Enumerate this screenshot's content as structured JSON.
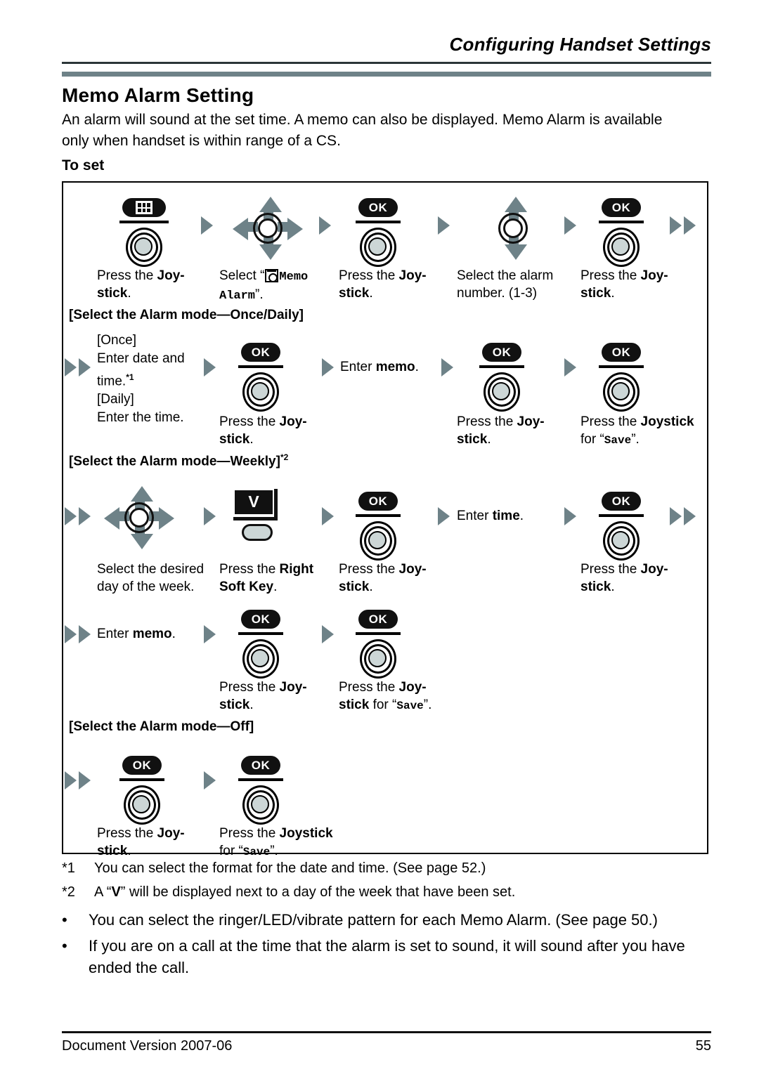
{
  "header": {
    "title": "Configuring Handset Settings"
  },
  "page_title": "Memo Alarm Setting",
  "intro": "An alarm will sound at the set time. A memo can also be displayed. Memo Alarm is available only when handset is within range of a CS.",
  "subhead": "To set",
  "flow": {
    "row1": {
      "captions": [
        "Press the Joy-stick.",
        "Select “[clock]Memo Alarm”.",
        "Press the Joy-stick.",
        "Select the alarm number. (1-3)",
        "Press the Joy-stick."
      ],
      "c1_a": "Press the ",
      "c1_b": "Joy-",
      "c1_c": "stick",
      "c1_d": ".",
      "c2_a": "Select “",
      "c2_mono1": "Memo",
      "c2_mono2": "Alarm",
      "c2_end": "”.",
      "c3_a": "Press the ",
      "c3_b": "Joy-",
      "c3_c": "stick",
      "c3_d": ".",
      "c4_l1": "Select the alarm",
      "c4_l2": "number. (1-3)",
      "c5_a": "Press the ",
      "c5_b": "Joy-",
      "c5_c": "stick",
      "c5_d": ".",
      "key1_label": "menu-grid",
      "key2_label": "OK",
      "key3_label": "OK"
    },
    "section_once": {
      "heading": "[Select the Alarm mode—Once/Daily]",
      "col1": [
        "[Once]",
        "Enter date and",
        "time.",
        "[Daily]",
        "Enter the time."
      ],
      "col1_sup": "*1",
      "ok_label": "OK",
      "cap_ok1_a": "Press the ",
      "cap_ok1_b": "Joy-",
      "cap_ok1_c": "stick",
      "cap_ok1_d": ".",
      "enter_memo_a": "Enter ",
      "enter_memo_b": "memo",
      "enter_memo_c": ".",
      "cap_ok2_a": "Press the ",
      "cap_ok2_b": "Joy-",
      "cap_ok2_c": "stick",
      "cap_ok2_d": ".",
      "cap_ok3_a": "Press the ",
      "cap_ok3_b": "Joystick",
      "cap_ok3_c": "for “",
      "cap_ok3_mono": "Save",
      "cap_ok3_d": "”."
    },
    "section_weekly": {
      "heading": "[Select the Alarm mode—Weekly]",
      "heading_sup": "*2",
      "softkey_glyph": "V",
      "ok_label": "OK",
      "cap_day_l1": "Select the desired",
      "cap_day_l2": "day of the week.",
      "cap_soft_a": "Press the ",
      "cap_soft_b": "Right",
      "cap_soft_c": "Soft Key",
      "cap_soft_d": ".",
      "cap_ok1_a": "Press the ",
      "cap_ok1_b": "Joy-",
      "cap_ok1_c": "stick",
      "cap_ok1_d": ".",
      "enter_time_a": "Enter ",
      "enter_time_b": "time",
      "enter_time_c": ".",
      "cap_ok2_a": "Press the ",
      "cap_ok2_b": "Joy-",
      "cap_ok2_c": "stick",
      "cap_ok2_d": ".",
      "enter_memo_a": "Enter ",
      "enter_memo_b": "memo",
      "enter_memo_c": ".",
      "cap_ok3_a": "Press the ",
      "cap_ok3_b": "Joy-",
      "cap_ok3_c": "stick",
      "cap_ok3_d": ".",
      "cap_ok4_a": "Press the ",
      "cap_ok4_b": "Joy-",
      "cap_ok4_c": "stick",
      "cap_ok4_d": " for “",
      "cap_ok4_mono": "Save",
      "cap_ok4_e": "”."
    },
    "section_off": {
      "heading": "[Select the Alarm mode—Off]",
      "ok_label": "OK",
      "cap_ok1_a": "Press the ",
      "cap_ok1_b": "Joy-",
      "cap_ok1_c": "stick",
      "cap_ok1_d": ".",
      "cap_ok2_a": "Press the ",
      "cap_ok2_b": "Joystick",
      "cap_ok2_c": "for “",
      "cap_ok2_mono": "Save",
      "cap_ok2_d": "”."
    }
  },
  "footnotes": [
    {
      "marker": "*1",
      "text": "You can select the format for the date and time. (See page 52.)"
    },
    {
      "marker": "*2",
      "text_a": "A “",
      "glyph": "V",
      "text_b": "” will be displayed next to a day of the week that have been set."
    }
  ],
  "bullets": [
    "You can select the ringer/LED/vibrate pattern for each Memo Alarm. (See page 50.)",
    "If you are on a call at the time that the alarm is set to sound, it will sound after you have ended the call."
  ],
  "footer": {
    "left": "Document Version 2007-06",
    "right": "55"
  }
}
